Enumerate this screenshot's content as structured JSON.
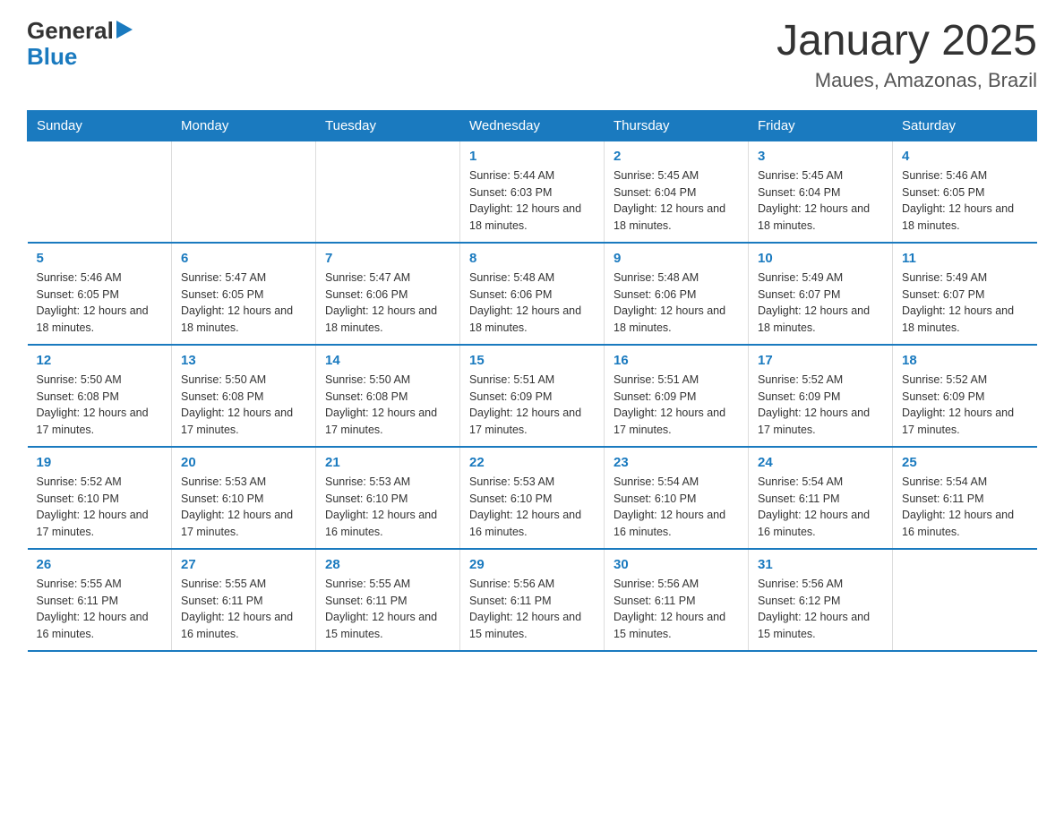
{
  "header": {
    "logo_general": "General",
    "logo_blue": "Blue",
    "title": "January 2025",
    "subtitle": "Maues, Amazonas, Brazil"
  },
  "days_of_week": [
    "Sunday",
    "Monday",
    "Tuesday",
    "Wednesday",
    "Thursday",
    "Friday",
    "Saturday"
  ],
  "weeks": [
    [
      null,
      null,
      null,
      {
        "day": "1",
        "sunrise": "Sunrise: 5:44 AM",
        "sunset": "Sunset: 6:03 PM",
        "daylight": "Daylight: 12 hours and 18 minutes."
      },
      {
        "day": "2",
        "sunrise": "Sunrise: 5:45 AM",
        "sunset": "Sunset: 6:04 PM",
        "daylight": "Daylight: 12 hours and 18 minutes."
      },
      {
        "day": "3",
        "sunrise": "Sunrise: 5:45 AM",
        "sunset": "Sunset: 6:04 PM",
        "daylight": "Daylight: 12 hours and 18 minutes."
      },
      {
        "day": "4",
        "sunrise": "Sunrise: 5:46 AM",
        "sunset": "Sunset: 6:05 PM",
        "daylight": "Daylight: 12 hours and 18 minutes."
      }
    ],
    [
      {
        "day": "5",
        "sunrise": "Sunrise: 5:46 AM",
        "sunset": "Sunset: 6:05 PM",
        "daylight": "Daylight: 12 hours and 18 minutes."
      },
      {
        "day": "6",
        "sunrise": "Sunrise: 5:47 AM",
        "sunset": "Sunset: 6:05 PM",
        "daylight": "Daylight: 12 hours and 18 minutes."
      },
      {
        "day": "7",
        "sunrise": "Sunrise: 5:47 AM",
        "sunset": "Sunset: 6:06 PM",
        "daylight": "Daylight: 12 hours and 18 minutes."
      },
      {
        "day": "8",
        "sunrise": "Sunrise: 5:48 AM",
        "sunset": "Sunset: 6:06 PM",
        "daylight": "Daylight: 12 hours and 18 minutes."
      },
      {
        "day": "9",
        "sunrise": "Sunrise: 5:48 AM",
        "sunset": "Sunset: 6:06 PM",
        "daylight": "Daylight: 12 hours and 18 minutes."
      },
      {
        "day": "10",
        "sunrise": "Sunrise: 5:49 AM",
        "sunset": "Sunset: 6:07 PM",
        "daylight": "Daylight: 12 hours and 18 minutes."
      },
      {
        "day": "11",
        "sunrise": "Sunrise: 5:49 AM",
        "sunset": "Sunset: 6:07 PM",
        "daylight": "Daylight: 12 hours and 18 minutes."
      }
    ],
    [
      {
        "day": "12",
        "sunrise": "Sunrise: 5:50 AM",
        "sunset": "Sunset: 6:08 PM",
        "daylight": "Daylight: 12 hours and 17 minutes."
      },
      {
        "day": "13",
        "sunrise": "Sunrise: 5:50 AM",
        "sunset": "Sunset: 6:08 PM",
        "daylight": "Daylight: 12 hours and 17 minutes."
      },
      {
        "day": "14",
        "sunrise": "Sunrise: 5:50 AM",
        "sunset": "Sunset: 6:08 PM",
        "daylight": "Daylight: 12 hours and 17 minutes."
      },
      {
        "day": "15",
        "sunrise": "Sunrise: 5:51 AM",
        "sunset": "Sunset: 6:09 PM",
        "daylight": "Daylight: 12 hours and 17 minutes."
      },
      {
        "day": "16",
        "sunrise": "Sunrise: 5:51 AM",
        "sunset": "Sunset: 6:09 PM",
        "daylight": "Daylight: 12 hours and 17 minutes."
      },
      {
        "day": "17",
        "sunrise": "Sunrise: 5:52 AM",
        "sunset": "Sunset: 6:09 PM",
        "daylight": "Daylight: 12 hours and 17 minutes."
      },
      {
        "day": "18",
        "sunrise": "Sunrise: 5:52 AM",
        "sunset": "Sunset: 6:09 PM",
        "daylight": "Daylight: 12 hours and 17 minutes."
      }
    ],
    [
      {
        "day": "19",
        "sunrise": "Sunrise: 5:52 AM",
        "sunset": "Sunset: 6:10 PM",
        "daylight": "Daylight: 12 hours and 17 minutes."
      },
      {
        "day": "20",
        "sunrise": "Sunrise: 5:53 AM",
        "sunset": "Sunset: 6:10 PM",
        "daylight": "Daylight: 12 hours and 17 minutes."
      },
      {
        "day": "21",
        "sunrise": "Sunrise: 5:53 AM",
        "sunset": "Sunset: 6:10 PM",
        "daylight": "Daylight: 12 hours and 16 minutes."
      },
      {
        "day": "22",
        "sunrise": "Sunrise: 5:53 AM",
        "sunset": "Sunset: 6:10 PM",
        "daylight": "Daylight: 12 hours and 16 minutes."
      },
      {
        "day": "23",
        "sunrise": "Sunrise: 5:54 AM",
        "sunset": "Sunset: 6:10 PM",
        "daylight": "Daylight: 12 hours and 16 minutes."
      },
      {
        "day": "24",
        "sunrise": "Sunrise: 5:54 AM",
        "sunset": "Sunset: 6:11 PM",
        "daylight": "Daylight: 12 hours and 16 minutes."
      },
      {
        "day": "25",
        "sunrise": "Sunrise: 5:54 AM",
        "sunset": "Sunset: 6:11 PM",
        "daylight": "Daylight: 12 hours and 16 minutes."
      }
    ],
    [
      {
        "day": "26",
        "sunrise": "Sunrise: 5:55 AM",
        "sunset": "Sunset: 6:11 PM",
        "daylight": "Daylight: 12 hours and 16 minutes."
      },
      {
        "day": "27",
        "sunrise": "Sunrise: 5:55 AM",
        "sunset": "Sunset: 6:11 PM",
        "daylight": "Daylight: 12 hours and 16 minutes."
      },
      {
        "day": "28",
        "sunrise": "Sunrise: 5:55 AM",
        "sunset": "Sunset: 6:11 PM",
        "daylight": "Daylight: 12 hours and 15 minutes."
      },
      {
        "day": "29",
        "sunrise": "Sunrise: 5:56 AM",
        "sunset": "Sunset: 6:11 PM",
        "daylight": "Daylight: 12 hours and 15 minutes."
      },
      {
        "day": "30",
        "sunrise": "Sunrise: 5:56 AM",
        "sunset": "Sunset: 6:11 PM",
        "daylight": "Daylight: 12 hours and 15 minutes."
      },
      {
        "day": "31",
        "sunrise": "Sunrise: 5:56 AM",
        "sunset": "Sunset: 6:12 PM",
        "daylight": "Daylight: 12 hours and 15 minutes."
      },
      null
    ]
  ]
}
